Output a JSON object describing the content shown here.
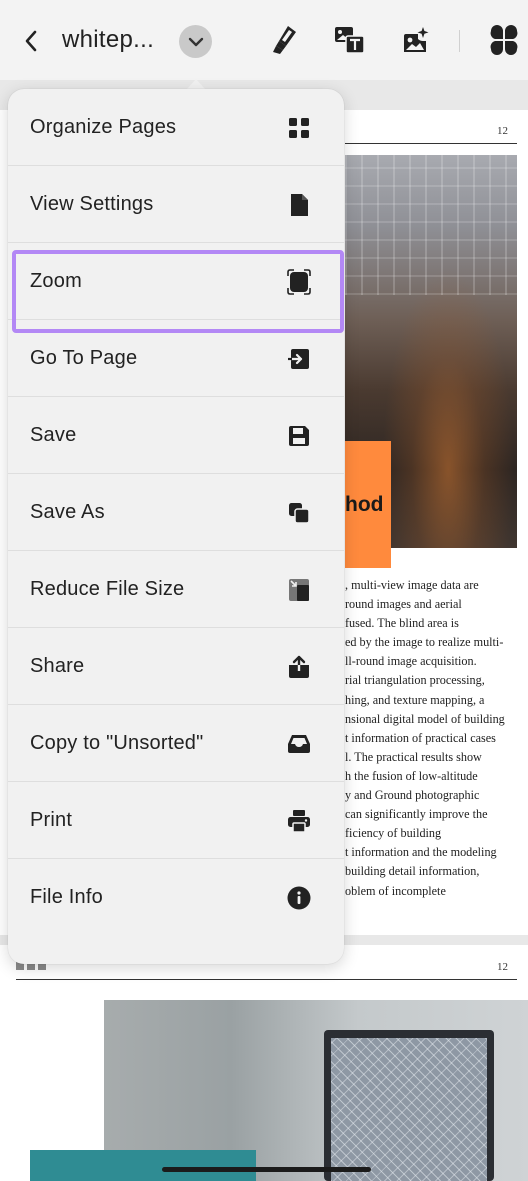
{
  "toolbar": {
    "back_icon": "chevron-left-icon",
    "doc_title": "whitep...",
    "title_dropdown_icon": "chevron-down-icon",
    "highlighter_icon": "highlighter-icon",
    "text_image_icon": "image-text-icon",
    "ai_image_icon": "ai-image-icon",
    "apps_icon": "four-petal-apps-icon"
  },
  "menu": {
    "items": [
      {
        "label": "Organize Pages",
        "icon": "grid-icon"
      },
      {
        "label": "View Settings",
        "icon": "document-icon"
      },
      {
        "label": "Zoom",
        "icon": "zoom-frame-icon"
      },
      {
        "label": "Go To Page",
        "icon": "go-to-page-icon"
      },
      {
        "label": "Save",
        "icon": "save-icon"
      },
      {
        "label": "Save As",
        "icon": "copy-icon"
      },
      {
        "label": "Reduce File Size",
        "icon": "compress-icon"
      },
      {
        "label": "Share",
        "icon": "share-icon"
      },
      {
        "label": "Copy to \"Unsorted\"",
        "icon": "inbox-icon"
      },
      {
        "label": "Print",
        "icon": "print-icon"
      },
      {
        "label": "File Info",
        "icon": "info-icon"
      }
    ],
    "highlighted_item": "Zoom",
    "highlight_color": "#b388f5"
  },
  "document": {
    "page1": {
      "page_number": "12",
      "heading_fragment": "hod",
      "body_lines": [
        ", multi-view image data are",
        "round images and aerial",
        "fused. The blind area is",
        "ed by the image to realize multi-",
        "ll-round image acquisition.",
        "rial triangulation processing,",
        "hing, and texture mapping, a",
        "nsional digital model of building",
        "t information of practical cases",
        "l. The practical results show",
        "h the fusion of low-altitude",
        "y and Ground photographic",
        "can significantly improve the",
        "ficiency of building",
        "t information and the modeling",
        "building detail information,",
        "oblem of incomplete"
      ],
      "accent_color": "#ff8a3d"
    },
    "page2": {
      "page_number": "12",
      "accent_color": "#2f8c93"
    }
  }
}
